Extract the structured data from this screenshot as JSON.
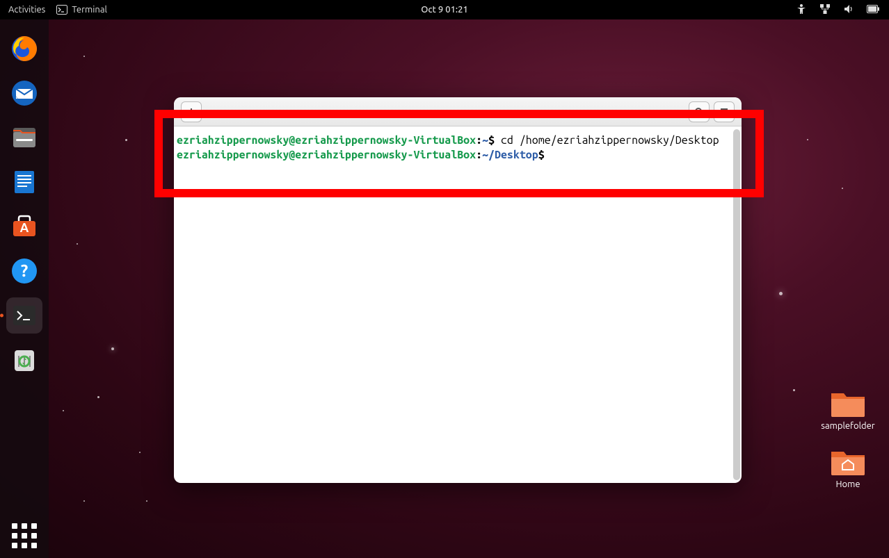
{
  "topbar": {
    "activities": "Activities",
    "active_app": "Terminal",
    "clock": "Oct 9  01:21"
  },
  "dock": {
    "items": [
      {
        "name": "firefox"
      },
      {
        "name": "thunderbird"
      },
      {
        "name": "files"
      },
      {
        "name": "libreoffice-writer"
      },
      {
        "name": "ubuntu-software"
      },
      {
        "name": "help"
      },
      {
        "name": "terminal",
        "active": true
      },
      {
        "name": "trash"
      }
    ]
  },
  "desktop_icons": [
    {
      "label": "samplefolder",
      "type": "folder"
    },
    {
      "label": "Home",
      "type": "home"
    }
  ],
  "terminal": {
    "prompt1": {
      "user_host": "ezriahzippernowsky@ezriahzippernowsky-VirtualBox",
      "path": "~",
      "command": "cd /home/ezriahzippernowsky/Desktop"
    },
    "prompt2": {
      "user_host": "ezriahzippernowsky@ezriahzippernowsky-VirtualBox",
      "path": "~/Desktop",
      "command": ""
    }
  },
  "annotation": {
    "present": true
  }
}
